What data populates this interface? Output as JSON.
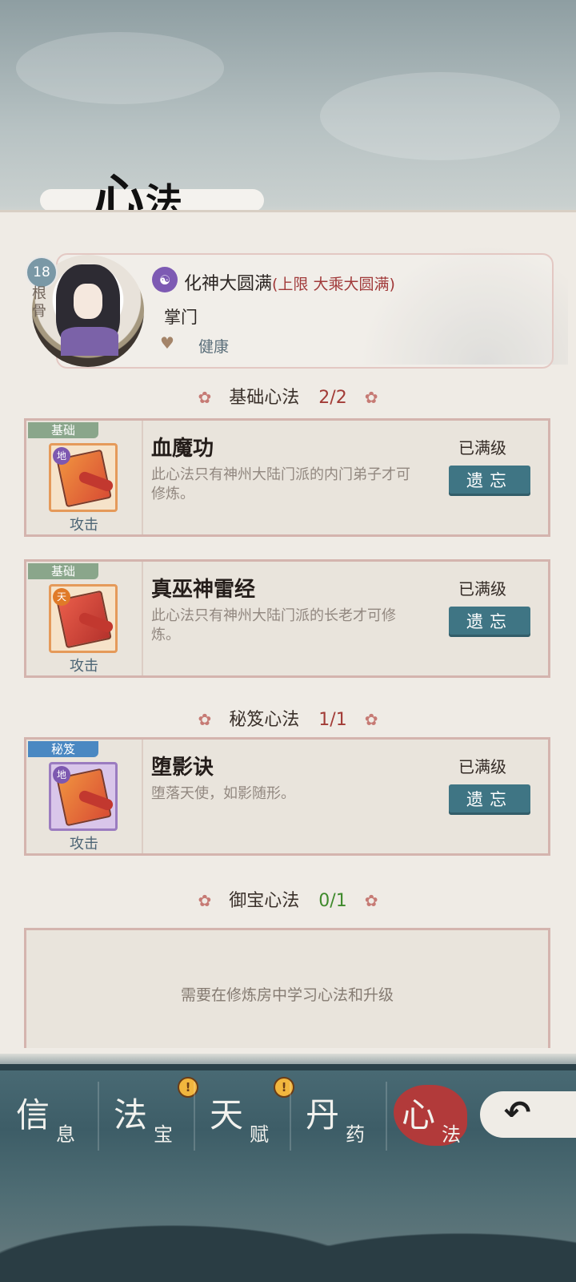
{
  "page": {
    "title_main": "心",
    "title_sub": "法"
  },
  "profile": {
    "root_value": "18",
    "root_label": "根骨",
    "realm": "化神大圆满",
    "realm_limit": "(上限 大乘大圆满)",
    "realm_icon": "realm-emblem-icon",
    "rank": "掌门",
    "health": "健康",
    "health_icon": "heart-plus-icon"
  },
  "sections": [
    {
      "title": "基础心法",
      "count": "2/2",
      "skills": [
        {
          "tag": "基础",
          "seal": "地",
          "name": "血魔功",
          "desc": "此心法只有神州大陆门派的内门弟子才可修炼。",
          "type": "攻击",
          "status": "已满级",
          "action": "遗忘"
        },
        {
          "tag": "基础",
          "seal": "天",
          "name": "真巫神雷经",
          "desc": "此心法只有神州大陆门派的长老才可修炼。",
          "type": "攻击",
          "status": "已满级",
          "action": "遗忘"
        }
      ]
    },
    {
      "title": "秘笈心法",
      "count": "1/1",
      "skills": [
        {
          "tag": "秘笈",
          "seal": "地",
          "name": "堕影诀",
          "desc": "堕落天使，如影随形。",
          "type": "攻击",
          "status": "已满级",
          "action": "遗忘"
        }
      ]
    },
    {
      "title": "御宝心法",
      "count": "0/1",
      "empty_text": "需要在修炼房中学习心法和升级"
    }
  ],
  "nav": [
    {
      "big": "信",
      "small": "息",
      "alert": false
    },
    {
      "big": "法",
      "small": "宝",
      "alert": true
    },
    {
      "big": "天",
      "small": "赋",
      "alert": true
    },
    {
      "big": "丹",
      "small": "药",
      "alert": false
    },
    {
      "big": "心",
      "small": "法",
      "active": true
    }
  ],
  "back_icon": "back-arrow-icon",
  "colors": {
    "accent_red": "#a23b36",
    "button_teal": "#3f7584",
    "count_green": "#3f8a2c"
  }
}
